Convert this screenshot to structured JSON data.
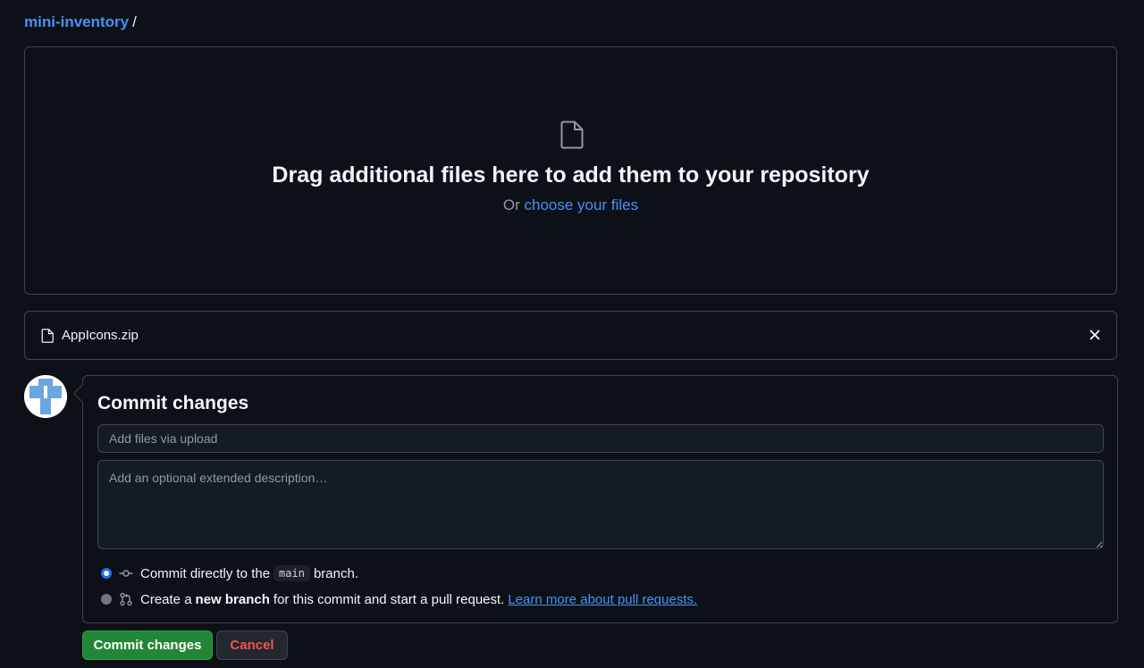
{
  "breadcrumb": {
    "repo": "mini-inventory",
    "separator": "/"
  },
  "dropzone": {
    "title": "Drag additional files here to add them to your repository",
    "or_text": "Or",
    "choose_link": "choose your files"
  },
  "file": {
    "name": "AppIcons.zip"
  },
  "commit": {
    "heading": "Commit changes",
    "summary_placeholder": "Add files via upload",
    "description_placeholder": "Add an optional extended description…",
    "option_direct": {
      "prefix": "Commit directly to the",
      "branch": "main",
      "suffix": "branch.",
      "selected": true
    },
    "option_new": {
      "prefix": "Create a",
      "bold": "new branch",
      "suffix": "for this commit and start a pull request.",
      "link": "Learn more about pull requests.",
      "selected": false
    }
  },
  "buttons": {
    "commit": "Commit changes",
    "cancel": "Cancel"
  },
  "colors": {
    "accent": "#4493f8",
    "primary_button": "#238636",
    "danger": "#f85149",
    "background": "#0d1117"
  }
}
